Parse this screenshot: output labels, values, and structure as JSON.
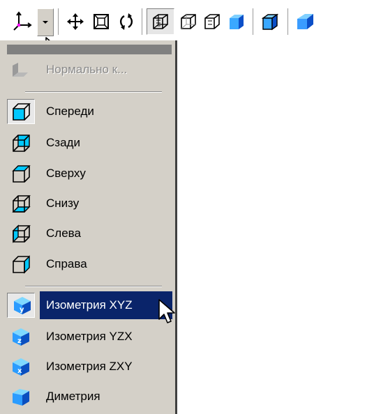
{
  "toolbar": {
    "buttons": [
      {
        "icon": "orientation-icon"
      },
      {
        "icon": "dropdown-arrow-icon"
      },
      {
        "icon": "pan-icon"
      },
      {
        "icon": "zoom-to-fit-icon"
      },
      {
        "icon": "rotate-icon"
      },
      {
        "icon": "wireframe-icon"
      },
      {
        "icon": "hidden-lines-icon"
      },
      {
        "icon": "hidden-lines-thin-icon"
      },
      {
        "icon": "shaded-icon"
      },
      {
        "icon": "shaded-with-edges-icon"
      },
      {
        "icon": "perspective-icon"
      }
    ]
  },
  "menu": {
    "normal_to": "Нормально к...",
    "views": [
      "Спереди",
      "Сзади",
      "Сверху",
      "Снизу",
      "Слева",
      "Справа"
    ],
    "iso": [
      "Изометрия XYZ",
      "Изометрия YZX",
      "Изометрия ZXY",
      "Диметрия"
    ],
    "selected_label": "Изометрия XYZ"
  },
  "colors": {
    "menu_bg": "#d4d0c8",
    "highlight": "#0a246a",
    "cube_cyan": "#00c8ff",
    "cube_blue": "#1060e0"
  }
}
